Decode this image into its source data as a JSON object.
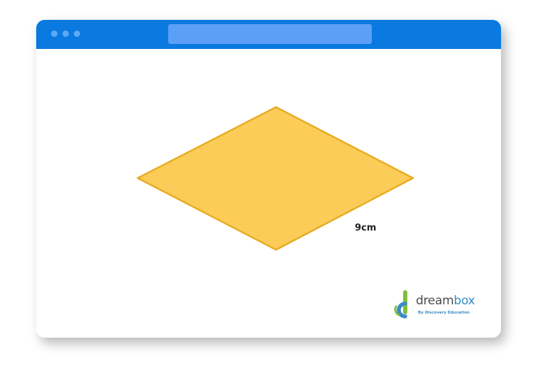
{
  "window": {
    "titlebar_color": "#0a79e0",
    "addressbar_color": "#5c9ff7",
    "dot_color": "#5ea8f5"
  },
  "diagram": {
    "shape": "rhombus",
    "fill": "#fccc58",
    "stroke": "#e8ad24",
    "side_label": "9cm"
  },
  "logo": {
    "word_part1": "dream",
    "word_part2": "box",
    "tagline": "By Discovery Education",
    "icon": "dreambox-d-icon",
    "colors": {
      "green": "#7fbf3f",
      "blue": "#3a8cc8",
      "gray": "#4c4c4c"
    }
  }
}
